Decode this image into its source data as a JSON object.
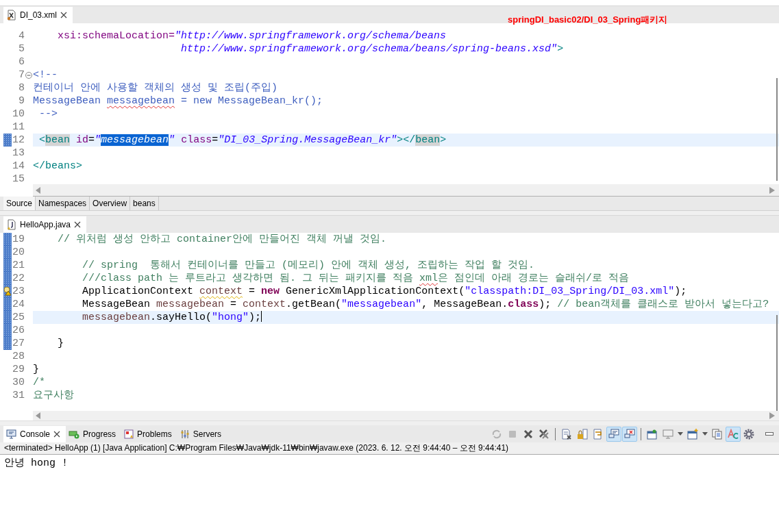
{
  "xml_editor": {
    "tab": {
      "title": "DI_03.xml",
      "selected": true
    },
    "annotation": "springDI_basic02/DI_03_Spring패키지",
    "lines": [
      {
        "number": "4",
        "changed": false,
        "current": false,
        "fold": false,
        "warning": false,
        "tokens": [
          {
            "text": "    xsi:schemaLocation=",
            "kind": "attr"
          },
          {
            "text": "\"http://www.springframework.org/schema/beans",
            "kind": "value"
          }
        ]
      },
      {
        "number": "5",
        "changed": false,
        "current": false,
        "fold": false,
        "warning": false,
        "tokens": [
          {
            "text": "                        http://www.springframework.org/schema/beans/spring-beans.xsd\"",
            "kind": "value"
          },
          {
            "text": ">",
            "kind": "tag"
          }
        ]
      },
      {
        "number": "6",
        "changed": false,
        "current": false,
        "fold": false,
        "warning": false
      },
      {
        "number": "7",
        "changed": false,
        "current": false,
        "fold": true,
        "warning": false,
        "tokens": [
          {
            "text": "<!--",
            "kind": "comment"
          }
        ]
      },
      {
        "number": "8",
        "changed": false,
        "current": false,
        "fold": false,
        "warning": false,
        "tokens": [
          {
            "text": "컨테이너 안에 사용할 객체의 생성 및 조립(주입)",
            "kind": "comment"
          }
        ]
      },
      {
        "number": "9",
        "changed": false,
        "current": false,
        "fold": false,
        "warning": false,
        "tokens": [
          {
            "text": "MessageBean ",
            "kind": "comment"
          },
          {
            "text": "messagebean",
            "kind": "misspelled"
          },
          {
            "text": " = new MessageBean_kr();",
            "kind": "comment"
          }
        ]
      },
      {
        "number": "10",
        "changed": false,
        "current": false,
        "fold": false,
        "warning": false,
        "tokens": [
          {
            "text": " -->",
            "kind": "comment"
          }
        ]
      },
      {
        "number": "11",
        "changed": false,
        "current": false,
        "fold": false,
        "warning": false
      },
      {
        "number": "12",
        "changed": true,
        "current": true,
        "fold": false,
        "warning": false,
        "tokens": [
          {
            "text": " <",
            "kind": "tag"
          },
          {
            "text": "bean",
            "kind": "occurrence"
          },
          {
            "text": " id",
            "kind": "attr"
          },
          {
            "text": "=",
            "kind": "plain"
          },
          {
            "text": "\"",
            "kind": "value"
          },
          {
            "text": "messagebean",
            "kind": "selection"
          },
          {
            "text": "\"",
            "kind": "value"
          },
          {
            "text": " class",
            "kind": "attr"
          },
          {
            "text": "=",
            "kind": "plain"
          },
          {
            "text": "\"DI_03_Spring.MessageBean_kr\"",
            "kind": "value"
          },
          {
            "text": "></",
            "kind": "tag"
          },
          {
            "text": "bean",
            "kind": "occurrence"
          },
          {
            "text": ">",
            "kind": "tag"
          }
        ]
      },
      {
        "number": "13",
        "changed": false,
        "current": false,
        "fold": false,
        "warning": false
      },
      {
        "number": "14",
        "changed": false,
        "current": false,
        "fold": false,
        "warning": false,
        "tokens": [
          {
            "text": "</beans>",
            "kind": "tag"
          }
        ]
      },
      {
        "number": "15",
        "changed": false,
        "current": false,
        "fold": false,
        "warning": false
      }
    ],
    "bottom_tabs": [
      {
        "label": "Source",
        "selected": true
      },
      {
        "label": "Namespaces",
        "selected": false
      },
      {
        "label": "Overview",
        "selected": false
      },
      {
        "label": "beans",
        "selected": false
      }
    ]
  },
  "java_editor": {
    "tab": {
      "title": "HelloApp.java",
      "selected": true
    },
    "lines": [
      {
        "number": "19",
        "changed": true,
        "current": false,
        "fold": false,
        "warning": false,
        "tokens": [
          {
            "text": "    // 위처럼 생성 안하고 container안에 만들어진 객체 꺼낼 것임.",
            "kind": "jcomment"
          }
        ]
      },
      {
        "number": "20",
        "changed": true,
        "current": false,
        "fold": false,
        "warning": false
      },
      {
        "number": "21",
        "changed": true,
        "current": false,
        "fold": false,
        "warning": false,
        "tokens": [
          {
            "text": "        // spring  통해서 컨테이너를 만들고 (메모리) 안에 객체 생성, 조립하는 작업 할 것임.",
            "kind": "jcomment"
          }
        ]
      },
      {
        "number": "22",
        "changed": true,
        "current": false,
        "fold": false,
        "warning": false,
        "tokens": [
          {
            "text": "        ///class path 는 루트라고 생각하면 됨. 그 뒤는 패키지를 적음 ",
            "kind": "jcomment"
          },
          {
            "text": "xml",
            "kind": "jmisspelled"
          },
          {
            "text": "은 점인데 아래 경로는 슬래쉬/로 적음",
            "kind": "jcomment"
          }
        ]
      },
      {
        "number": "23",
        "changed": true,
        "current": false,
        "fold": false,
        "warning": true,
        "tokens": [
          {
            "text": "        ApplicationContext ",
            "kind": "plain"
          },
          {
            "text": "context",
            "kind": "unused"
          },
          {
            "text": " = ",
            "kind": "plain"
          },
          {
            "text": "new",
            "kind": "keyword"
          },
          {
            "text": " GenericXmlApplicationContext(",
            "kind": "plain"
          },
          {
            "text": "\"classpath:DI_03_Spring/DI_03.xml\"",
            "kind": "string"
          },
          {
            "text": ");",
            "kind": "plain"
          }
        ]
      },
      {
        "number": "24",
        "changed": true,
        "current": false,
        "fold": false,
        "warning": false,
        "tokens": [
          {
            "text": "        MessageBean ",
            "kind": "plain"
          },
          {
            "text": "messagebean",
            "kind": "var"
          },
          {
            "text": " = ",
            "kind": "plain"
          },
          {
            "text": "context",
            "kind": "var"
          },
          {
            "text": ".getBean(",
            "kind": "plain"
          },
          {
            "text": "\"messagebean\"",
            "kind": "string"
          },
          {
            "text": ", MessageBean.",
            "kind": "plain"
          },
          {
            "text": "class",
            "kind": "keyword"
          },
          {
            "text": "); ",
            "kind": "plain"
          },
          {
            "text": "// bean객체를 클래스로 받아서 넣는다고?",
            "kind": "jcomment"
          }
        ]
      },
      {
        "number": "25",
        "changed": true,
        "current": true,
        "fold": false,
        "warning": false,
        "tokens": [
          {
            "text": "        messagebean",
            "kind": "var"
          },
          {
            "text": ".sayHello(",
            "kind": "plain"
          },
          {
            "text": "\"hong\"",
            "kind": "string"
          },
          {
            "text": ");",
            "kind": "plain"
          }
        ]
      },
      {
        "number": "26",
        "changed": true,
        "current": false,
        "fold": false,
        "warning": false
      },
      {
        "number": "27",
        "changed": true,
        "current": false,
        "fold": false,
        "warning": false,
        "tokens": [
          {
            "text": "    }",
            "kind": "plain"
          }
        ]
      },
      {
        "number": "28",
        "changed": false,
        "current": false,
        "fold": false,
        "warning": false
      },
      {
        "number": "29",
        "changed": false,
        "current": false,
        "fold": false,
        "warning": false,
        "tokens": [
          {
            "text": "}",
            "kind": "plain"
          }
        ]
      },
      {
        "number": "30",
        "changed": false,
        "current": false,
        "fold": false,
        "warning": false,
        "tokens": [
          {
            "text": "/*",
            "kind": "jcomment"
          }
        ]
      },
      {
        "number": "31",
        "changed": false,
        "current": false,
        "fold": false,
        "warning": false,
        "tokens": [
          {
            "text": "요구사항",
            "kind": "jcomment"
          }
        ]
      }
    ]
  },
  "console": {
    "tabs": [
      {
        "label": "Console",
        "selected": true
      },
      {
        "label": "Progress",
        "selected": false
      },
      {
        "label": "Problems",
        "selected": false
      },
      {
        "label": "Servers",
        "selected": false
      }
    ],
    "toolbar": [
      {
        "kind": "relaunch",
        "pressed": false,
        "disabled": true
      },
      {
        "kind": "terminate",
        "pressed": false,
        "disabled": true
      },
      {
        "kind": "remove",
        "pressed": false,
        "disabled": false
      },
      {
        "kind": "remove-all",
        "pressed": false,
        "disabled": false
      },
      {
        "kind": "separator"
      },
      {
        "kind": "clear",
        "pressed": false,
        "disabled": false
      },
      {
        "kind": "scroll-lock",
        "pressed": false,
        "disabled": false
      },
      {
        "kind": "word-wrap",
        "pressed": false,
        "disabled": false
      },
      {
        "kind": "stdout",
        "pressed": true,
        "disabled": false
      },
      {
        "kind": "stderr",
        "pressed": true,
        "disabled": false
      },
      {
        "kind": "separator"
      },
      {
        "kind": "pin",
        "pressed": false,
        "disabled": false
      },
      {
        "kind": "display",
        "pressed": false,
        "disabled": false
      },
      {
        "kind": "dropdown",
        "pressed": false,
        "disabled": false
      },
      {
        "kind": "new-console",
        "pressed": false,
        "disabled": false
      },
      {
        "kind": "dropdown",
        "pressed": false,
        "disabled": false
      },
      {
        "kind": "copy",
        "pressed": false,
        "disabled": false
      },
      {
        "kind": "ansi",
        "pressed": true,
        "disabled": false
      },
      {
        "kind": "settings",
        "pressed": false,
        "disabled": false
      }
    ],
    "status": "<terminated> HelloApp (1) [Java Application] C:₩Program Files₩Java₩jdk-11₩bin₩javaw.exe  (2023. 6. 12. 오전 9:44:40 – 오전 9:44:41)",
    "output": "안녕 hong !"
  }
}
